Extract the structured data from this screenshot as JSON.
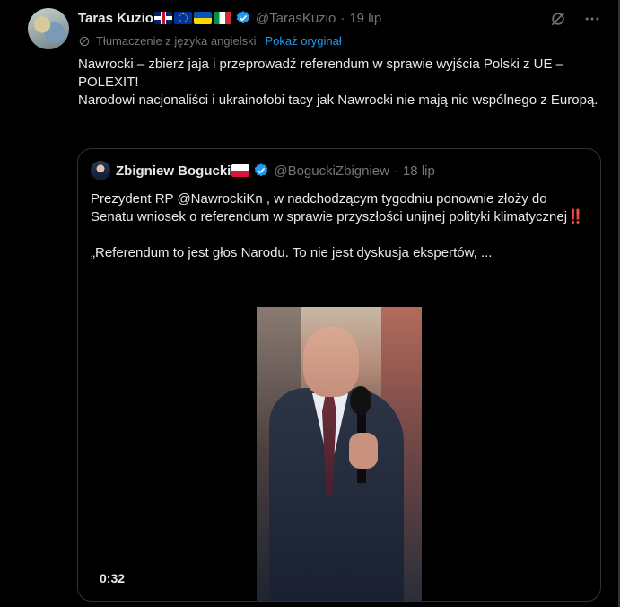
{
  "tweet": {
    "author_name": "Taras Kuzio",
    "flags": [
      "uk-flag",
      "eu-flag",
      "ukraine-flag",
      "italy-flag"
    ],
    "handle": "@TarasKuzio",
    "separator": "·",
    "date": "19 lip",
    "translation_note": "Tłumaczenie z języka angielski",
    "show_original": "Pokaż oryginał",
    "text_lines": [
      "Nawrocki – zbierz jaja i przeprowadź referendum w sprawie wyjścia Polski z UE – POLEXIT!",
      "Narodowi nacjonaliści i ukrainofobi tacy jak Nawrocki nie mają nic wspólnego z Europą."
    ]
  },
  "quote": {
    "author_name": "Zbigniew Bogucki",
    "flag": "poland-flag",
    "handle": "@BoguckiZbigniew",
    "separator": "·",
    "date": "18 lip",
    "text_main": "Prezydent RP @NawrockiKn , w nadchodzącym tygodniu ponownie złoży do Senatu wniosek o referendum w sprawie przyszłości unijnej polityki klimatycznej",
    "emphasis": "‼️",
    "text_quote": "„Referendum to jest głos Narodu. To nie jest dyskusja ekspertów, ...",
    "video_duration": "0:32"
  },
  "icons": {
    "grok": "grok-icon",
    "more": "more-icon",
    "verified": "verified-icon"
  },
  "colors": {
    "background": "#000000",
    "text": "#e7e9ea",
    "muted": "#71767b",
    "link": "#1d9bf0",
    "verified": "#1d9bf0",
    "border": "#2f3336"
  }
}
